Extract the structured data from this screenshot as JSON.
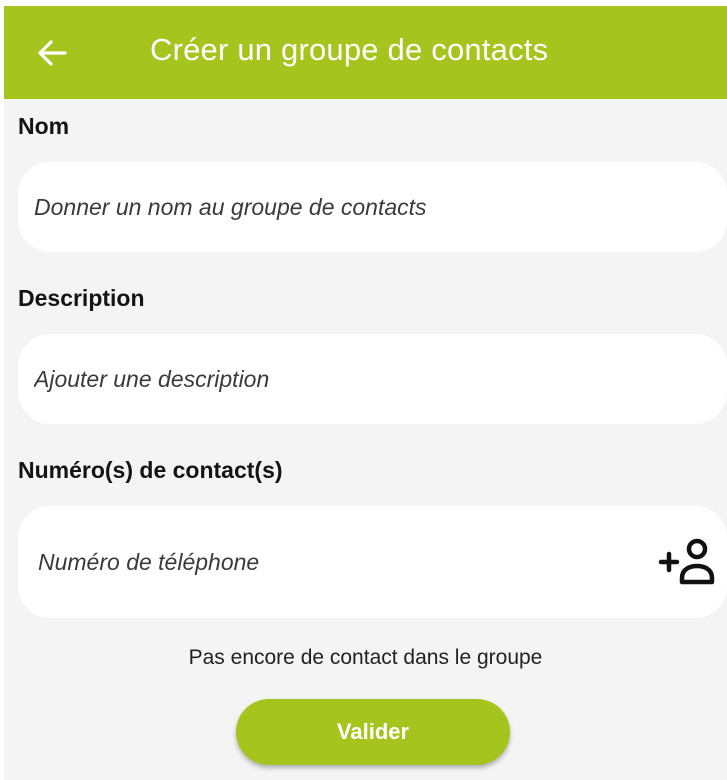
{
  "app_bar": {
    "title": "Créer un groupe de contacts",
    "back_icon": "arrow-left-icon",
    "background": "#a5c41d"
  },
  "form": {
    "name": {
      "label": "Nom",
      "placeholder": "Donner un nom au groupe de contacts",
      "value": ""
    },
    "description": {
      "label": "Description",
      "placeholder": "Ajouter une description",
      "value": ""
    },
    "contacts": {
      "label": "Numéro(s) de contact(s)",
      "placeholder": "Numéro de téléphone",
      "value": "",
      "add_icon": "add-person-icon"
    },
    "empty_message": "Pas encore de contact dans le groupe",
    "submit_label": "Valider"
  },
  "colors": {
    "accent": "#a5c41d",
    "screen_background": "#f4f4f4",
    "field_background": "#ffffff"
  }
}
